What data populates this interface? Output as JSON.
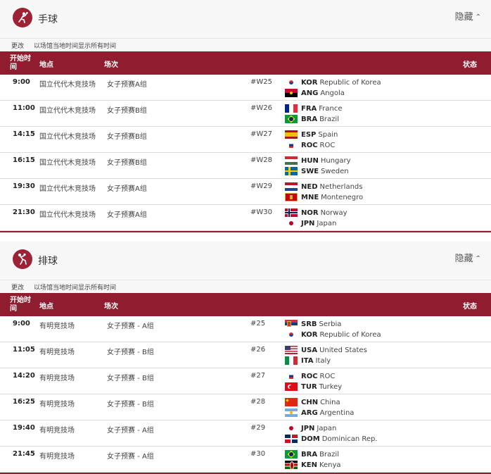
{
  "common": {
    "th_time": "开始时间",
    "th_venue": "地点",
    "th_event": "场次",
    "th_status": "状态",
    "change_label": "更改",
    "tz_note": "以场馆当地时间显示所有时间",
    "hide_label": "隐藏"
  },
  "sections": [
    {
      "title": "手球",
      "icon": "handball-icon",
      "rows": [
        {
          "time": "9:00",
          "venue": "国立代代木竞技场",
          "event": "女子预赛A组",
          "code": "#W25",
          "t1": {
            "abbr": "KOR",
            "name": "Republic of Korea",
            "flag": "kor"
          },
          "t2": {
            "abbr": "ANG",
            "name": "Angola",
            "flag": "ang"
          }
        },
        {
          "time": "11:00",
          "venue": "国立代代木竞技场",
          "event": "女子预赛B组",
          "code": "#W26",
          "t1": {
            "abbr": "FRA",
            "name": "France",
            "flag": "fra"
          },
          "t2": {
            "abbr": "BRA",
            "name": "Brazil",
            "flag": "bra"
          }
        },
        {
          "time": "14:15",
          "venue": "国立代代木竞技场",
          "event": "女子预赛B组",
          "code": "#W27",
          "t1": {
            "abbr": "ESP",
            "name": "Spain",
            "flag": "esp"
          },
          "t2": {
            "abbr": "ROC",
            "name": "ROC",
            "flag": "roc"
          }
        },
        {
          "time": "16:15",
          "venue": "国立代代木竞技场",
          "event": "女子预赛B组",
          "code": "#W28",
          "t1": {
            "abbr": "HUN",
            "name": "Hungary",
            "flag": "hun"
          },
          "t2": {
            "abbr": "SWE",
            "name": "Sweden",
            "flag": "swe"
          }
        },
        {
          "time": "19:30",
          "venue": "国立代代木竞技场",
          "event": "女子预赛A组",
          "code": "#W29",
          "t1": {
            "abbr": "NED",
            "name": "Netherlands",
            "flag": "ned"
          },
          "t2": {
            "abbr": "MNE",
            "name": "Montenegro",
            "flag": "mne"
          }
        },
        {
          "time": "21:30",
          "venue": "国立代代木竞技场",
          "event": "女子预赛A组",
          "code": "#W30",
          "t1": {
            "abbr": "NOR",
            "name": "Norway",
            "flag": "nor"
          },
          "t2": {
            "abbr": "JPN",
            "name": "Japan",
            "flag": "jpn"
          }
        }
      ]
    },
    {
      "title": "排球",
      "icon": "volleyball-icon",
      "rows": [
        {
          "time": "9:00",
          "venue": "有明竞技场",
          "event": "女子预赛 - A组",
          "code": "#25",
          "t1": {
            "abbr": "SRB",
            "name": "Serbia",
            "flag": "srb"
          },
          "t2": {
            "abbr": "KOR",
            "name": "Republic of Korea",
            "flag": "kor"
          }
        },
        {
          "time": "11:05",
          "venue": "有明竞技场",
          "event": "女子预赛 - B组",
          "code": "#26",
          "t1": {
            "abbr": "USA",
            "name": "United States",
            "flag": "usa"
          },
          "t2": {
            "abbr": "ITA",
            "name": "Italy",
            "flag": "ita"
          }
        },
        {
          "time": "14:20",
          "venue": "有明竞技场",
          "event": "女子预赛 - B组",
          "code": "#27",
          "t1": {
            "abbr": "ROC",
            "name": "ROC",
            "flag": "roc"
          },
          "t2": {
            "abbr": "TUR",
            "name": "Turkey",
            "flag": "tur"
          }
        },
        {
          "time": "16:25",
          "venue": "有明竞技场",
          "event": "女子预赛 - B组",
          "code": "#28",
          "t1": {
            "abbr": "CHN",
            "name": "China",
            "flag": "chn"
          },
          "t2": {
            "abbr": "ARG",
            "name": "Argentina",
            "flag": "arg"
          }
        },
        {
          "time": "19:40",
          "venue": "有明竞技场",
          "event": "女子预赛 - A组",
          "code": "#29",
          "t1": {
            "abbr": "JPN",
            "name": "Japan",
            "flag": "jpn"
          },
          "t2": {
            "abbr": "DOM",
            "name": "Dominican Rep.",
            "flag": "dom"
          }
        },
        {
          "time": "21:45",
          "venue": "有明竞技场",
          "event": "女子预赛 - A组",
          "code": "#30",
          "t1": {
            "abbr": "BRA",
            "name": "Brazil",
            "flag": "bra"
          },
          "t2": {
            "abbr": "KEN",
            "name": "Kenya",
            "flag": "ken"
          }
        }
      ]
    }
  ]
}
